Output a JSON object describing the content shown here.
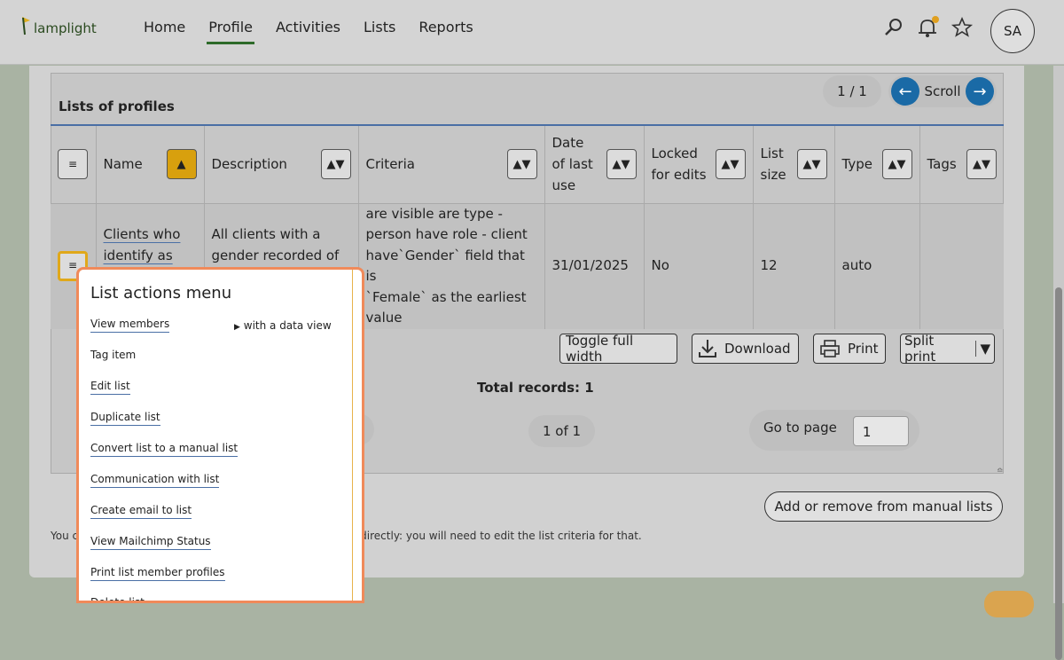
{
  "app": {
    "logo_text": "lamplight"
  },
  "nav": [
    {
      "label": "Home",
      "active": false
    },
    {
      "label": "Profile",
      "active": true
    },
    {
      "label": "Activities",
      "active": false
    },
    {
      "label": "Lists",
      "active": false
    },
    {
      "label": "Reports",
      "active": false
    }
  ],
  "user": {
    "initials": "SA"
  },
  "section": {
    "title": "Lists of profiles",
    "pager": "1 / 1",
    "scroll_label": "Scroll"
  },
  "table": {
    "headers": {
      "name": "Name",
      "description": "Description",
      "criteria": "Criteria",
      "date_line1": "Date",
      "date_line2": "of last",
      "date_line3": "use",
      "locked_line1": "Locked",
      "locked_line2": "for edits",
      "size_line1": "List",
      "size_line2": "size",
      "type": "Type",
      "tags": "Tags"
    },
    "row": {
      "name_line1": "Clients who",
      "name_line2": "identify as",
      "description_line1": "All clients with a",
      "description_line2": "gender recorded of",
      "criteria_line1": "are visible are type -",
      "criteria_line2": "person have role - client",
      "criteria_line3": "have`Gender` field that is",
      "criteria_line4": "`Female` as the earliest",
      "criteria_line5": "value",
      "date": "31/01/2025",
      "locked": "No",
      "size": "12",
      "type": "auto",
      "tags": ""
    }
  },
  "toolbar": {
    "toggle": "Toggle full width",
    "download": "Download",
    "print": "Print",
    "split_print": "Split print"
  },
  "totals": {
    "label": "Total records: 1"
  },
  "pagination": {
    "page_of": "1 of 1",
    "go_to_label": "Go to page",
    "page_value": "1"
  },
  "footer": {
    "note_start": "You c",
    "note_end": "s directly: you will need to edit the list criteria for that.",
    "manual_button": "Add or remove from manual lists"
  },
  "menu": {
    "title": "List actions menu",
    "items": [
      {
        "label": "View members"
      },
      {
        "label": "Tag item"
      },
      {
        "label": "Edit list"
      },
      {
        "label": "Duplicate list"
      },
      {
        "label": "Convert list to a manual list"
      },
      {
        "label": "Communication with list"
      },
      {
        "label": "Create email to list"
      },
      {
        "label": "View Mailchimp Status"
      },
      {
        "label": "Print list member profiles"
      },
      {
        "label": "Delete list"
      }
    ],
    "submenu_label": "with a data view"
  }
}
